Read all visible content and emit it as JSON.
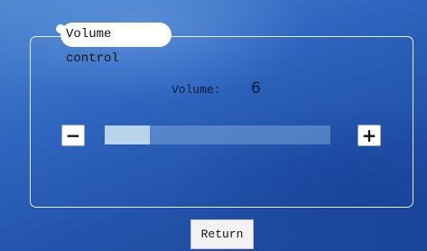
{
  "panel": {
    "title": "Volume control"
  },
  "volume": {
    "label": "Volume:",
    "value": "6",
    "level_fraction": 0.2,
    "decrease_symbol": "−",
    "increase_symbol": "+"
  },
  "footer": {
    "return_label": "Return"
  },
  "colors": {
    "background": "#2f66c0",
    "track": "#7aa5d7",
    "fill": "#b9d3ec"
  }
}
